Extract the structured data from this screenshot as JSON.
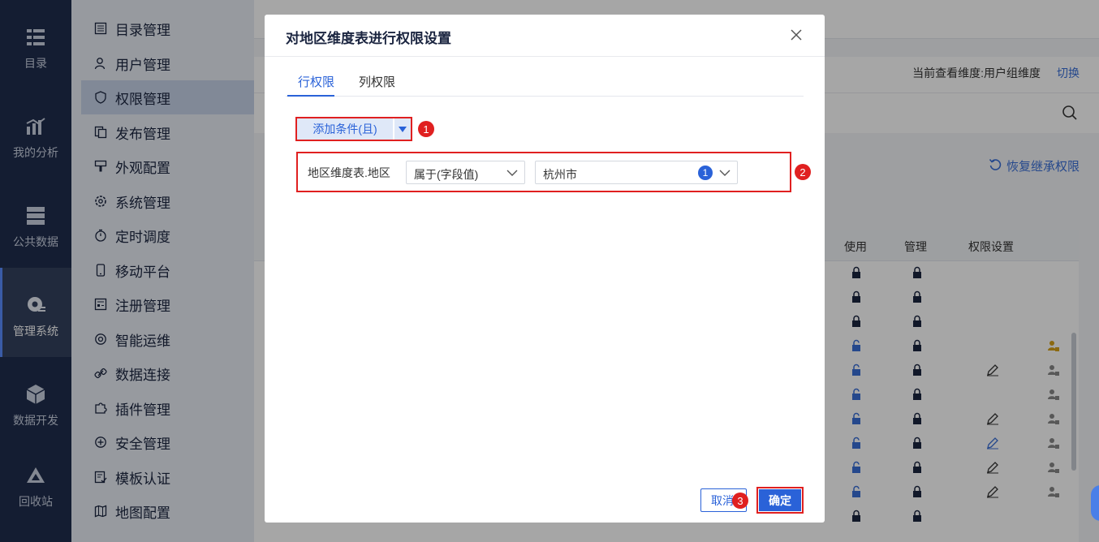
{
  "rail": {
    "items": [
      {
        "label": "目录",
        "icon": "catalog-icon"
      },
      {
        "label": "我的分析",
        "icon": "analysis-icon"
      },
      {
        "label": "公共数据",
        "icon": "database-icon"
      },
      {
        "label": "管理系统",
        "icon": "gear-icon",
        "active": true
      },
      {
        "label": "数据开发",
        "icon": "cube-icon"
      },
      {
        "label": "回收站",
        "icon": "recycle-icon"
      }
    ]
  },
  "submenu": {
    "items": [
      {
        "label": "目录管理"
      },
      {
        "label": "用户管理"
      },
      {
        "label": "权限管理",
        "active": true
      },
      {
        "label": "发布管理"
      },
      {
        "label": "外观配置"
      },
      {
        "label": "系统管理"
      },
      {
        "label": "定时调度"
      },
      {
        "label": "移动平台"
      },
      {
        "label": "注册管理"
      },
      {
        "label": "智能运维"
      },
      {
        "label": "数据连接"
      },
      {
        "label": "插件管理"
      },
      {
        "label": "安全管理"
      },
      {
        "label": "模板认证"
      },
      {
        "label": "地图配置"
      }
    ]
  },
  "main": {
    "current_dimension": "当前查看维度:用户组维度",
    "switch_label": "切换",
    "restore_label": "恢复继承权限",
    "table_headers": {
      "use": "使用",
      "manage": "管理",
      "perm_setting": "权限设置"
    }
  },
  "modal": {
    "title": "对地区维度表进行权限设置",
    "tabs": [
      {
        "label": "行权限",
        "active": true
      },
      {
        "label": "列权限"
      }
    ],
    "add_condition_label": "添加条件(且)",
    "condition": {
      "field_label": "地区维度表.地区",
      "operator": "属于(字段值)",
      "value": "杭州市",
      "value_count": "1"
    },
    "cancel_label": "取消",
    "ok_label": "确定",
    "annotations": {
      "step1": "1",
      "step2": "2",
      "step3": "3"
    }
  },
  "colors": {
    "accent": "#2a62d8",
    "annotation": "#e02020",
    "rail_bg": "#1f2d4e"
  }
}
